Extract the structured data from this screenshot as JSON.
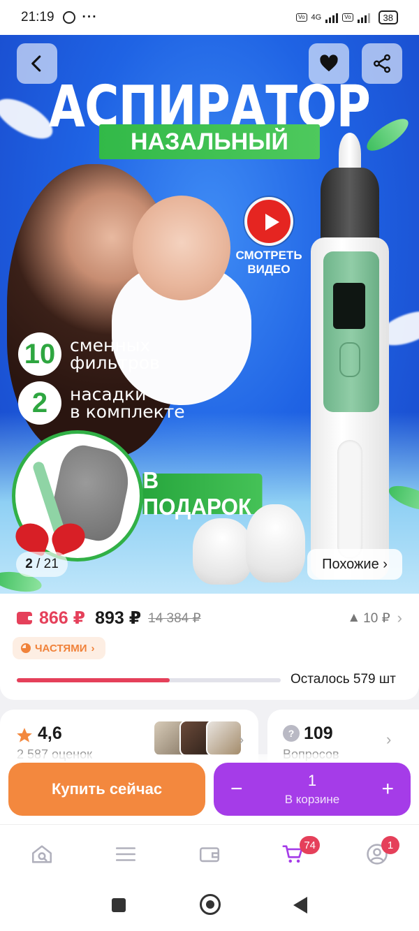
{
  "status_bar": {
    "time": "21:19",
    "dots": "···",
    "network": "4G",
    "battery": "38"
  },
  "hero": {
    "title": "АСПИРАТОР",
    "subtitle": "НАЗАЛЬНЫЙ",
    "video_label": "СМОТРЕТЬ ВИДЕО",
    "features": [
      {
        "number": "10",
        "text_line1": "сменных",
        "text_line2": "фильтров"
      },
      {
        "number": "2",
        "text_line1": "насадки",
        "text_line2": "в комплекте"
      }
    ],
    "gift_label": "В ПОДАРОК",
    "counter_current": "2",
    "counter_total": "21",
    "similar_label": "Похожие ›"
  },
  "price": {
    "main": "866 ₽",
    "second": "893 ₽",
    "old": "14 384 ₽",
    "increase": "10 ₽",
    "parts_label": "ЧАСТЯМИ",
    "progress_fraction": 0.58,
    "left_text": "Осталось 579 шт"
  },
  "reviews": {
    "rating": "4,6",
    "count_label": "2 587 оценок"
  },
  "questions": {
    "count": "109",
    "label": "Вопросов"
  },
  "actions": {
    "buy_label": "Купить сейчас",
    "cart_qty": "1",
    "cart_label": "В корзине",
    "minus": "−",
    "plus": "+"
  },
  "tabbar": {
    "cart_badge": "74",
    "profile_badge": "1"
  },
  "colors": {
    "accent_red": "#e5405a",
    "buy_orange": "#f3883e",
    "cart_purple": "#a53ce8",
    "green": "#31b046"
  }
}
